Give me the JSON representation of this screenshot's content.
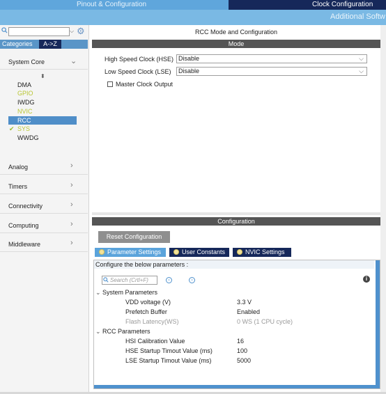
{
  "top_tabs": {
    "pinout": "Pinout & Configuration",
    "clock": "Clock Configuration",
    "additional": "Additional Softw"
  },
  "left_panel": {
    "tabs": {
      "categories": "Categories",
      "atoz": "A->Z"
    },
    "sections": [
      "System Core",
      "Analog",
      "Timers",
      "Connectivity",
      "Computing",
      "Middleware"
    ],
    "system_core_items": [
      {
        "label": "DMA",
        "color": "#222222"
      },
      {
        "label": "GPIO",
        "color": "#b9c633"
      },
      {
        "label": "IWDG",
        "color": "#222222"
      },
      {
        "label": "NVIC",
        "color": "#b9c633"
      },
      {
        "label": "RCC",
        "color": "#ffffff"
      },
      {
        "label": "SYS",
        "color": "#b9c633"
      },
      {
        "label": "WWDG",
        "color": "#222222"
      }
    ]
  },
  "main": {
    "title": "RCC Mode and Configuration",
    "mode_bar": "Mode",
    "hse": {
      "label": "High Speed Clock (HSE)",
      "value": "Disable"
    },
    "lse": {
      "label": "Low Speed Clock (LSE)",
      "value": "Disable"
    },
    "mco_label": "Master Clock Output",
    "config_bar": "Configuration",
    "reset_button": "Reset Configuration",
    "param_tabs": [
      "Parameter Settings",
      "User Constants",
      "NVIC Settings"
    ],
    "params_caption": "Configure the below parameters :",
    "search_placeholder": "Search (Crtl+F)",
    "groups": {
      "system": {
        "title": "System Parameters",
        "rows": [
          {
            "name": "VDD voltage (V)",
            "value": "3.3 V"
          },
          {
            "name": "Prefetch Buffer",
            "value": "Enabled"
          },
          {
            "name": "Flash Latency(WS)",
            "value": "0 WS (1 CPU cycle)"
          }
        ]
      },
      "rcc": {
        "title": "RCC Parameters",
        "rows": [
          {
            "name": "HSI Calibration Value",
            "value": "16"
          },
          {
            "name": "HSE Startup Timout Value (ms)",
            "value": "100"
          },
          {
            "name": "LSE Startup Timout Value (ms)",
            "value": "5000"
          }
        ]
      }
    }
  }
}
